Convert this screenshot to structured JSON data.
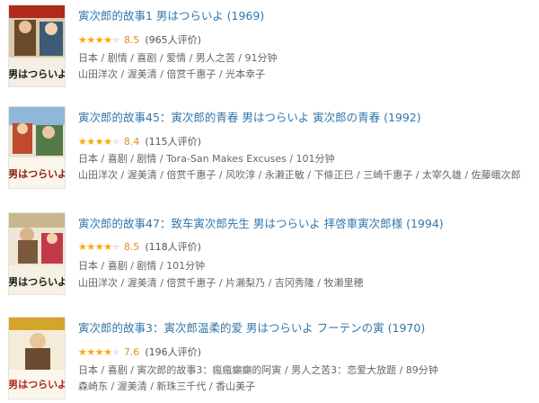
{
  "colors": {
    "link": "#3377aa",
    "star": "#ffa800",
    "score": "#e09015",
    "meta": "#666666"
  },
  "movies": [
    {
      "title": "寅次郎的故事1 男はつらいよ (1969)",
      "rating": 8.5,
      "stars_fraction": 0.85,
      "score": "8.5",
      "votes": "(965人评价)",
      "tags": "日本 / 剧情 / 喜剧 / 爱情 / 男人之苦 / 91分钟",
      "cast": "山田洋次 / 渥美清 / 倍赏千惠子 / 光本幸子",
      "poster_text": "男はつらいよ"
    },
    {
      "title": "寅次郎的故事45：寅次郎的青春 男はつらいよ 寅次郎の青春 (1992)",
      "rating": 8.4,
      "stars_fraction": 0.84,
      "score": "8.4",
      "votes": "(115人评价)",
      "tags": "日本 / 喜剧 / 剧情 / Tora-San Makes Excuses / 101分钟",
      "cast": "山田洋次 / 渥美清 / 倍赏千惠子 / 风吹淳 / 永濑正敏 / 下條正巳 / 三崎千惠子 / 太宰久雄 / 佐藤蛾次郎",
      "poster_text": "男はつらいよ"
    },
    {
      "title": "寅次郎的故事47：致车寅次郎先生 男はつらいよ 拝啓車寅次郎様 (1994)",
      "rating": 8.5,
      "stars_fraction": 0.85,
      "score": "8.5",
      "votes": "(118人评价)",
      "tags": "日本 / 喜剧 / 剧情 / 101分钟",
      "cast": "山田洋次 / 渥美清 / 倍赏千惠子 / 片濑梨乃 / 吉冈秀隆 / 牧濑里穂",
      "poster_text": "男はつらいよ"
    },
    {
      "title": "寅次郎的故事3：寅次郎温柔的爱 男はつらいよ フーテンの寅 (1970)",
      "rating": 7.6,
      "stars_fraction": 0.76,
      "score": "7.6",
      "votes": "(196人评价)",
      "tags": "日本 / 喜剧 / 寅次郎的故事3：瘋瘋癲癲的阿寅 / 男人之苦3：恋爱大放题 / 89分钟",
      "cast": "森崎东 / 渥美清 / 新珠三千代 / 香山美子",
      "poster_text": "男はつらいよ"
    }
  ]
}
